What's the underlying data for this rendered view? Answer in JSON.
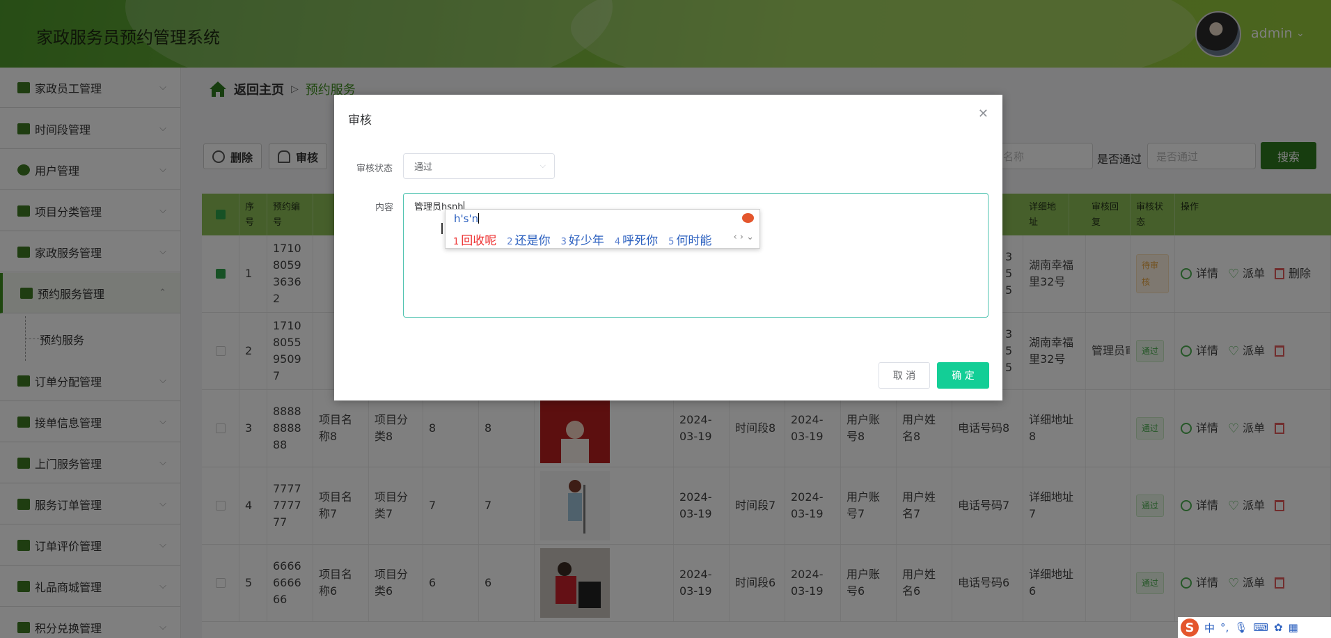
{
  "header": {
    "title": "家政服务员预约管理系统",
    "user": "admin"
  },
  "sidebar": {
    "items": [
      {
        "label": "家政员工管理"
      },
      {
        "label": "时间段管理"
      },
      {
        "label": "用户管理"
      },
      {
        "label": "项目分类管理"
      },
      {
        "label": "家政服务管理"
      },
      {
        "label": "预约服务管理"
      },
      {
        "label": "订单分配管理"
      },
      {
        "label": "接单信息管理"
      },
      {
        "label": "上门服务管理"
      },
      {
        "label": "服务订单管理"
      },
      {
        "label": "订单评价管理"
      },
      {
        "label": "礼品商城管理"
      },
      {
        "label": "积分兑换管理"
      }
    ],
    "sub_item": "预约服务"
  },
  "breadcrumb": {
    "home": "返回主页",
    "sep": "▷",
    "current": "预约服务"
  },
  "toolbar": {
    "delete": "删除",
    "review": "审核",
    "search_placeholder": "名称",
    "passed_label": "是否通过",
    "passed_placeholder": "是否通过",
    "search": "搜索"
  },
  "table": {
    "headers": [
      "序号",
      "预约编号",
      "详细地址",
      "审核回复",
      "审核状态",
      "操作"
    ],
    "rows": [
      {
        "idx": "1",
        "no": "1710805936362",
        "addr": "湖南幸福里32号",
        "reply": "",
        "status": "待审核",
        "phone_tail": "35 5"
      },
      {
        "idx": "2",
        "no": "1710805595097",
        "addr": "湖南幸福里32号",
        "reply": "管理员审核",
        "status": "通过",
        "phone_tail": "35 5"
      },
      {
        "idx": "3",
        "no": "8888888888",
        "proj": "项目名称8",
        "cat": "项目分类8",
        "a": "8",
        "b": "8",
        "date": "2024-03-19",
        "slot": "时间段8",
        "date2": "2024-03-19",
        "acct": "用户账号8",
        "uname": "用户姓名8",
        "phone": "电话号码8",
        "addr": "详细地址8",
        "reply": "",
        "status": "通过"
      },
      {
        "idx": "4",
        "no": "7777777777",
        "proj": "项目名称7",
        "cat": "项目分类7",
        "a": "7",
        "b": "7",
        "date": "2024-03-19",
        "slot": "时间段7",
        "date2": "2024-03-19",
        "acct": "用户账号7",
        "uname": "用户姓名7",
        "phone": "电话号码7",
        "addr": "详细地址7",
        "reply": "",
        "status": "通过"
      },
      {
        "idx": "5",
        "no": "6666666666",
        "proj": "项目名称6",
        "cat": "项目分类6",
        "a": "6",
        "b": "6",
        "date": "2024-03-19",
        "slot": "时间段6",
        "date2": "2024-03-19",
        "acct": "用户账号6",
        "uname": "用户姓名6",
        "phone": "电话号码6",
        "addr": "详细地址6",
        "reply": "",
        "status": "通过"
      }
    ],
    "ops": {
      "detail": "详情",
      "dispatch": "派单",
      "delete": "删除"
    }
  },
  "dialog": {
    "title": "审核",
    "status_label": "审核状态",
    "status_value": "通过",
    "content_label": "内容",
    "content_value": "管理员hsnh",
    "cancel": "取 消",
    "ok": "确 定"
  },
  "ime": {
    "pinyin": "h's'n",
    "candidates": [
      {
        "n": "1",
        "text": "回收呢"
      },
      {
        "n": "2",
        "text": "还是你"
      },
      {
        "n": "3",
        "text": "好少年"
      },
      {
        "n": "4",
        "text": "呼死你"
      },
      {
        "n": "5",
        "text": "何时能"
      }
    ]
  },
  "tray": {
    "lang": "中",
    "punct": "°,"
  }
}
